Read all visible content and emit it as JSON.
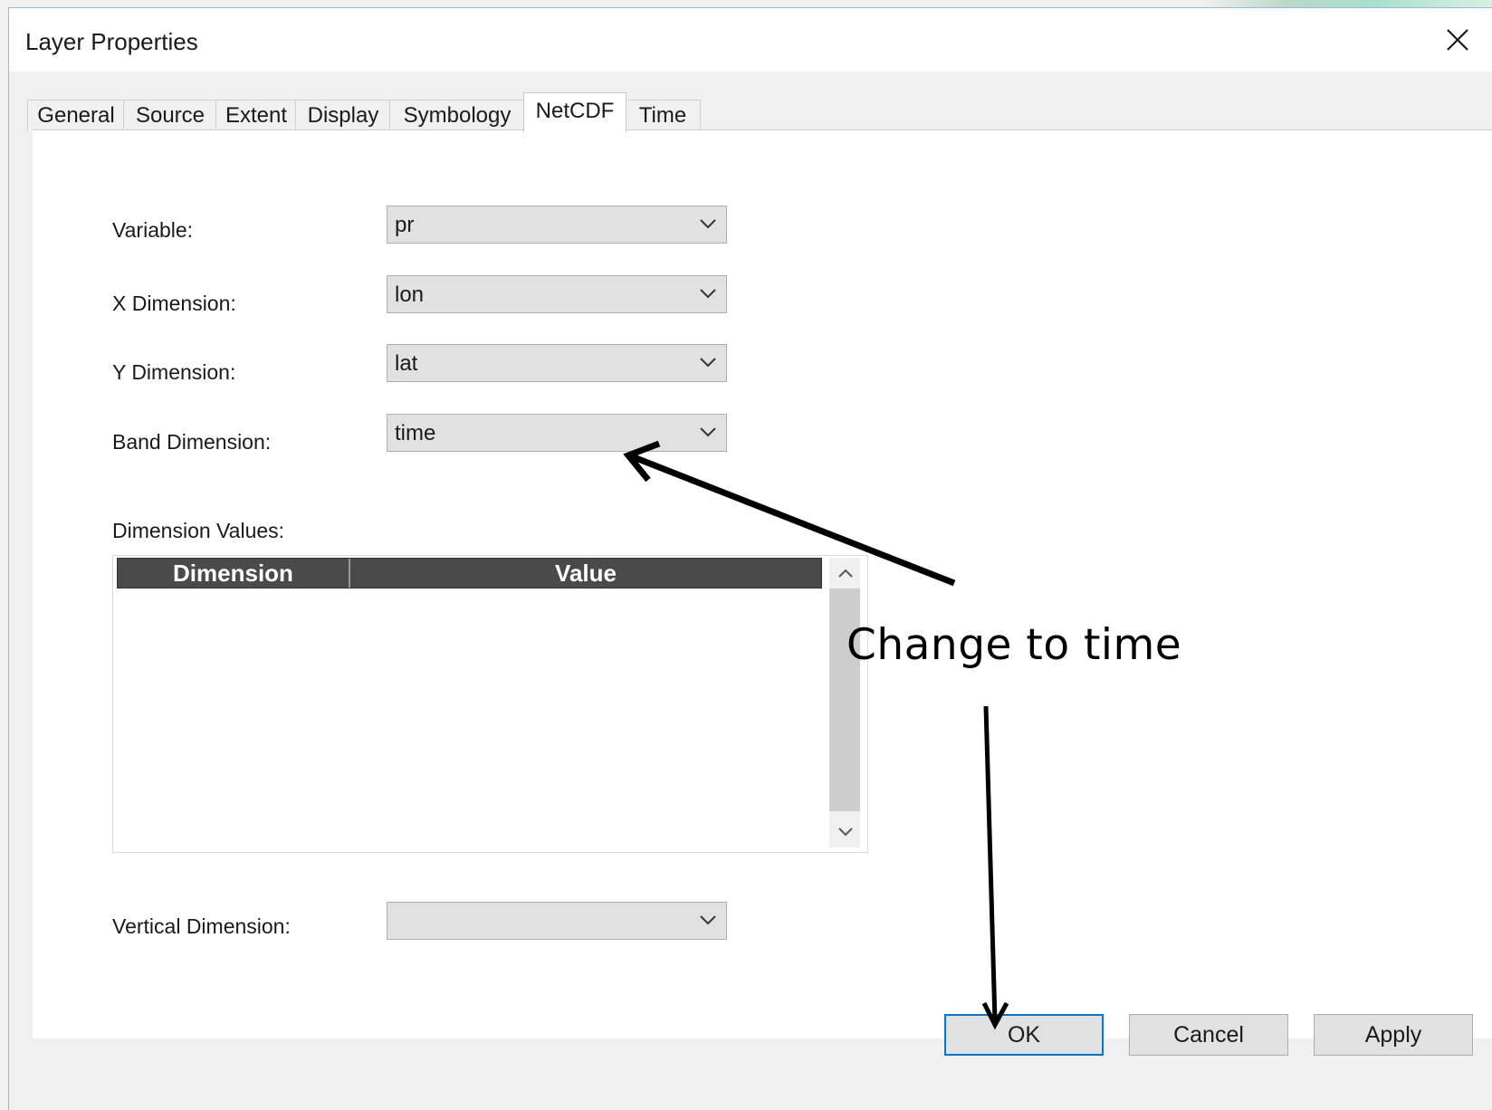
{
  "window": {
    "title": "Layer Properties"
  },
  "tabs": [
    {
      "label": "General"
    },
    {
      "label": "Source"
    },
    {
      "label": "Extent"
    },
    {
      "label": "Display"
    },
    {
      "label": "Symbology"
    },
    {
      "label": "NetCDF",
      "active": true
    },
    {
      "label": "Time"
    }
  ],
  "form": {
    "variable": {
      "label": "Variable:",
      "value": "pr"
    },
    "x_dimension": {
      "label": "X Dimension:",
      "value": "lon"
    },
    "y_dimension": {
      "label": "Y Dimension:",
      "value": "lat"
    },
    "band_dimension": {
      "label": "Band Dimension:",
      "value": "time"
    },
    "dimension_values": {
      "label": "Dimension Values:",
      "columns": [
        "Dimension",
        "Value"
      ],
      "rows": []
    },
    "vertical_dimension": {
      "label": "Vertical Dimension:",
      "value": ""
    }
  },
  "buttons": {
    "ok": "OK",
    "cancel": "Cancel",
    "apply": "Apply"
  },
  "annotation": {
    "text": "Change to time"
  },
  "icons": {
    "close": "close-icon",
    "dropdown": "chevron-down-icon",
    "scroll_up": "chevron-up-icon",
    "scroll_down": "chevron-down-icon"
  },
  "colors": {
    "default_button_border": "#0078d7",
    "grid_header": "#4a4a4a"
  }
}
